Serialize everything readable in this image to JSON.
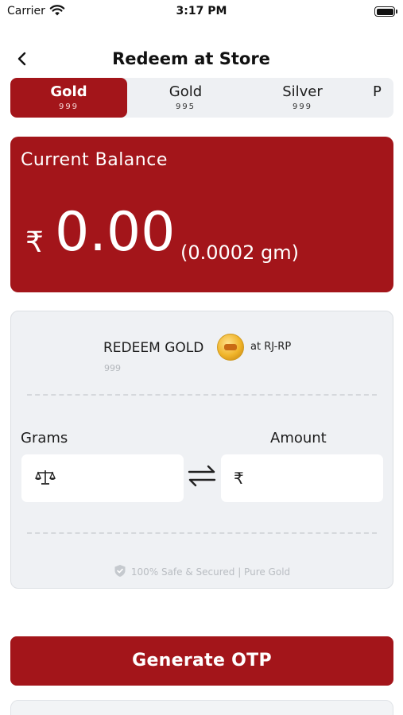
{
  "status_bar": {
    "carrier": "Carrier",
    "time": "3:17 PM"
  },
  "header": {
    "title": "Redeem at Store"
  },
  "tabs": [
    {
      "name": "Gold",
      "purity": "999",
      "active": true
    },
    {
      "name": "Gold",
      "purity": "995",
      "active": false
    },
    {
      "name": "Silver",
      "purity": "999",
      "active": false
    },
    {
      "name": "P",
      "purity": "",
      "active": false
    }
  ],
  "balance": {
    "title": "Current Balance",
    "currency": "₹",
    "amount": "0.00",
    "grams": "(0.0002 gm)"
  },
  "redeem": {
    "label": "REDEEM GOLD",
    "store": "at RJ-RP",
    "purity": "999",
    "grams_label": "Grams",
    "amount_label": "Amount",
    "amount_currency": "₹",
    "secure_text": "100% Safe & Secured | Pure Gold"
  },
  "icons": {
    "back": "chevron-left-icon",
    "wifi": "wifi-icon",
    "battery": "battery-icon",
    "scale": "scale-icon",
    "swap": "swap-arrows-icon",
    "shield": "shield-check-icon",
    "coin": "gold-coin-icon"
  },
  "colors": {
    "brand": "#a3151a",
    "card_bg": "#eff1f4"
  },
  "cta": {
    "label": "Generate OTP"
  }
}
